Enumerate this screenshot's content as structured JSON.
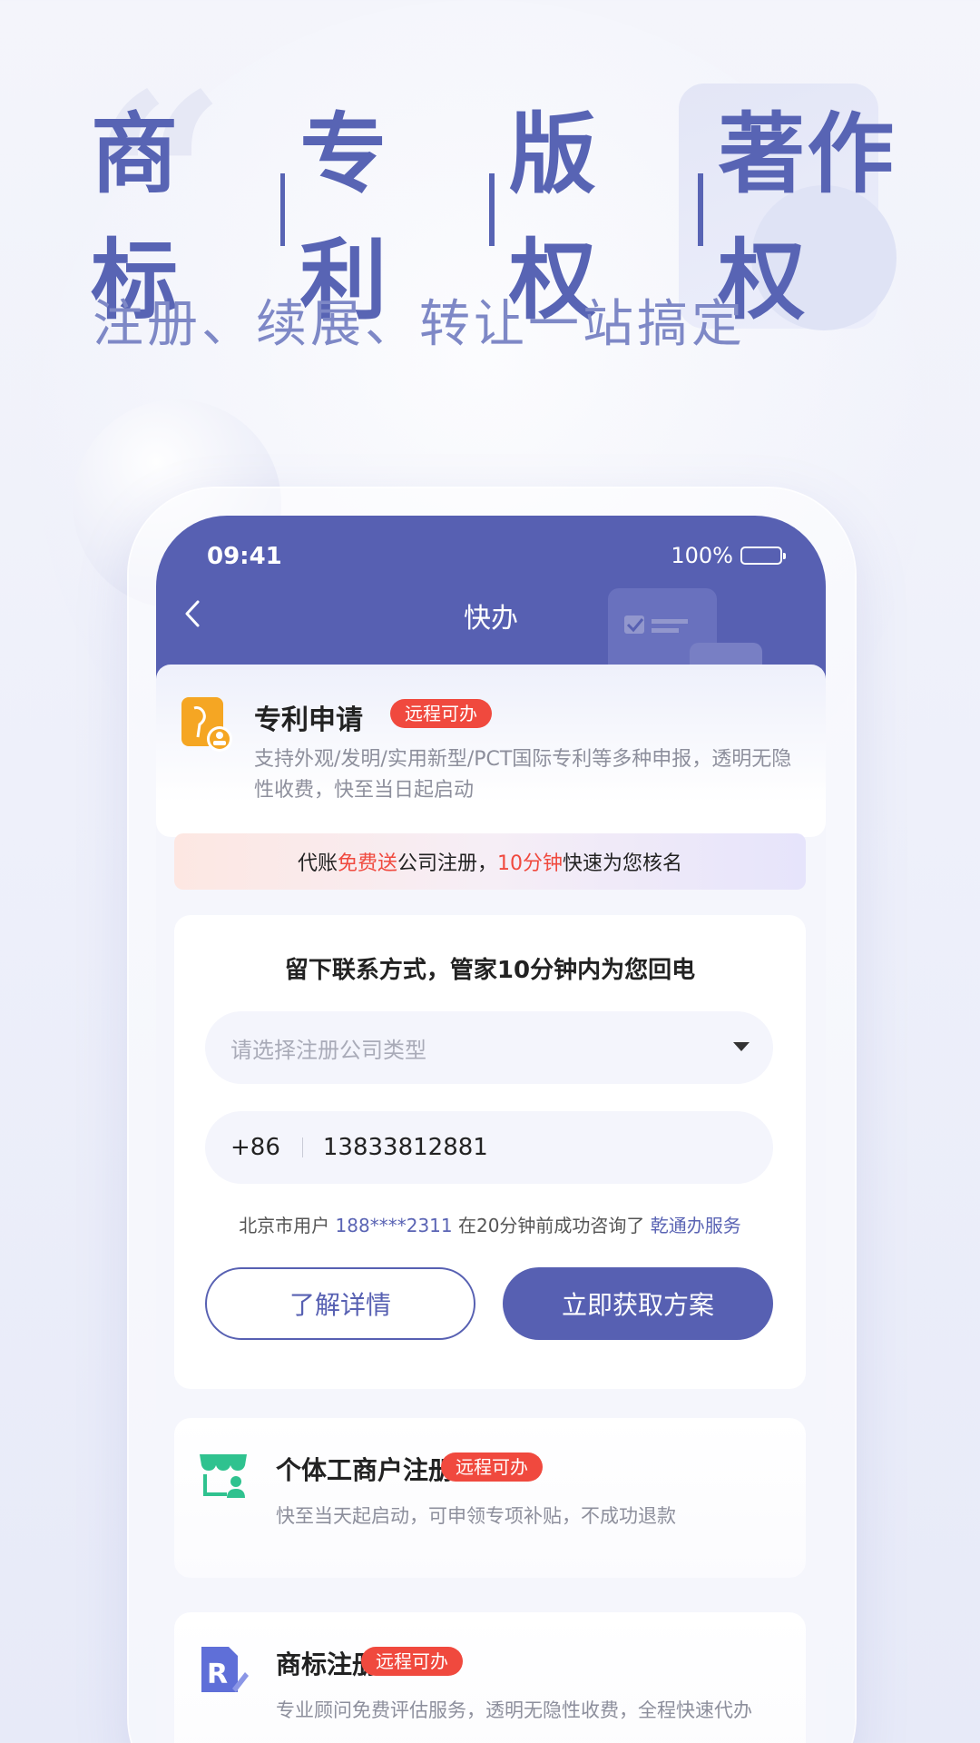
{
  "promo": {
    "headline": [
      "商标",
      "专利",
      "版权",
      "著作权"
    ],
    "subline": "注册、续展、转让一站搞定"
  },
  "status_bar": {
    "time": "09:41",
    "battery": "100%"
  },
  "nav": {
    "title": "快办"
  },
  "service": {
    "title": "专利申请",
    "tag": "远程可办",
    "description": "支持外观/发明/实用新型/PCT国际专利等多种申报，透明无隐性收费，快至当日起启动"
  },
  "promo_bar": {
    "part1": "代账",
    "highlight1": "免费送",
    "part2": "公司注册，",
    "highlight2": "10分钟",
    "part3": "快速为您核名"
  },
  "form": {
    "title": "留下联系方式，管家10分钟内为您回电",
    "select_placeholder": "请选择注册公司类型",
    "country_code": "+86",
    "phone_value": "13833812881",
    "recent_prefix": "北京市用户",
    "recent_phone": "188****2311",
    "recent_middle": "在20分钟前成功咨询了",
    "recent_service": "乾通办服务",
    "btn_details": "了解详情",
    "btn_get_plan": "立即获取方案"
  },
  "list": [
    {
      "title": "个体工商户注册",
      "tag": "远程可办",
      "description": "快至当天起启动，可申领专项补贴，不成功退款",
      "icon": "storefront-icon"
    },
    {
      "title": "商标注册",
      "tag": "远程可办",
      "description": "专业顾问免费评估服务，透明无隐性收费，全程快速代办",
      "icon": "trademark-icon"
    }
  ],
  "colors": {
    "primary": "#5760b2",
    "accent_red": "#f0493e",
    "heading": "#5864b4",
    "subheading": "#7e88c6",
    "green": "#2fc28f",
    "orange": "#f5a623"
  }
}
